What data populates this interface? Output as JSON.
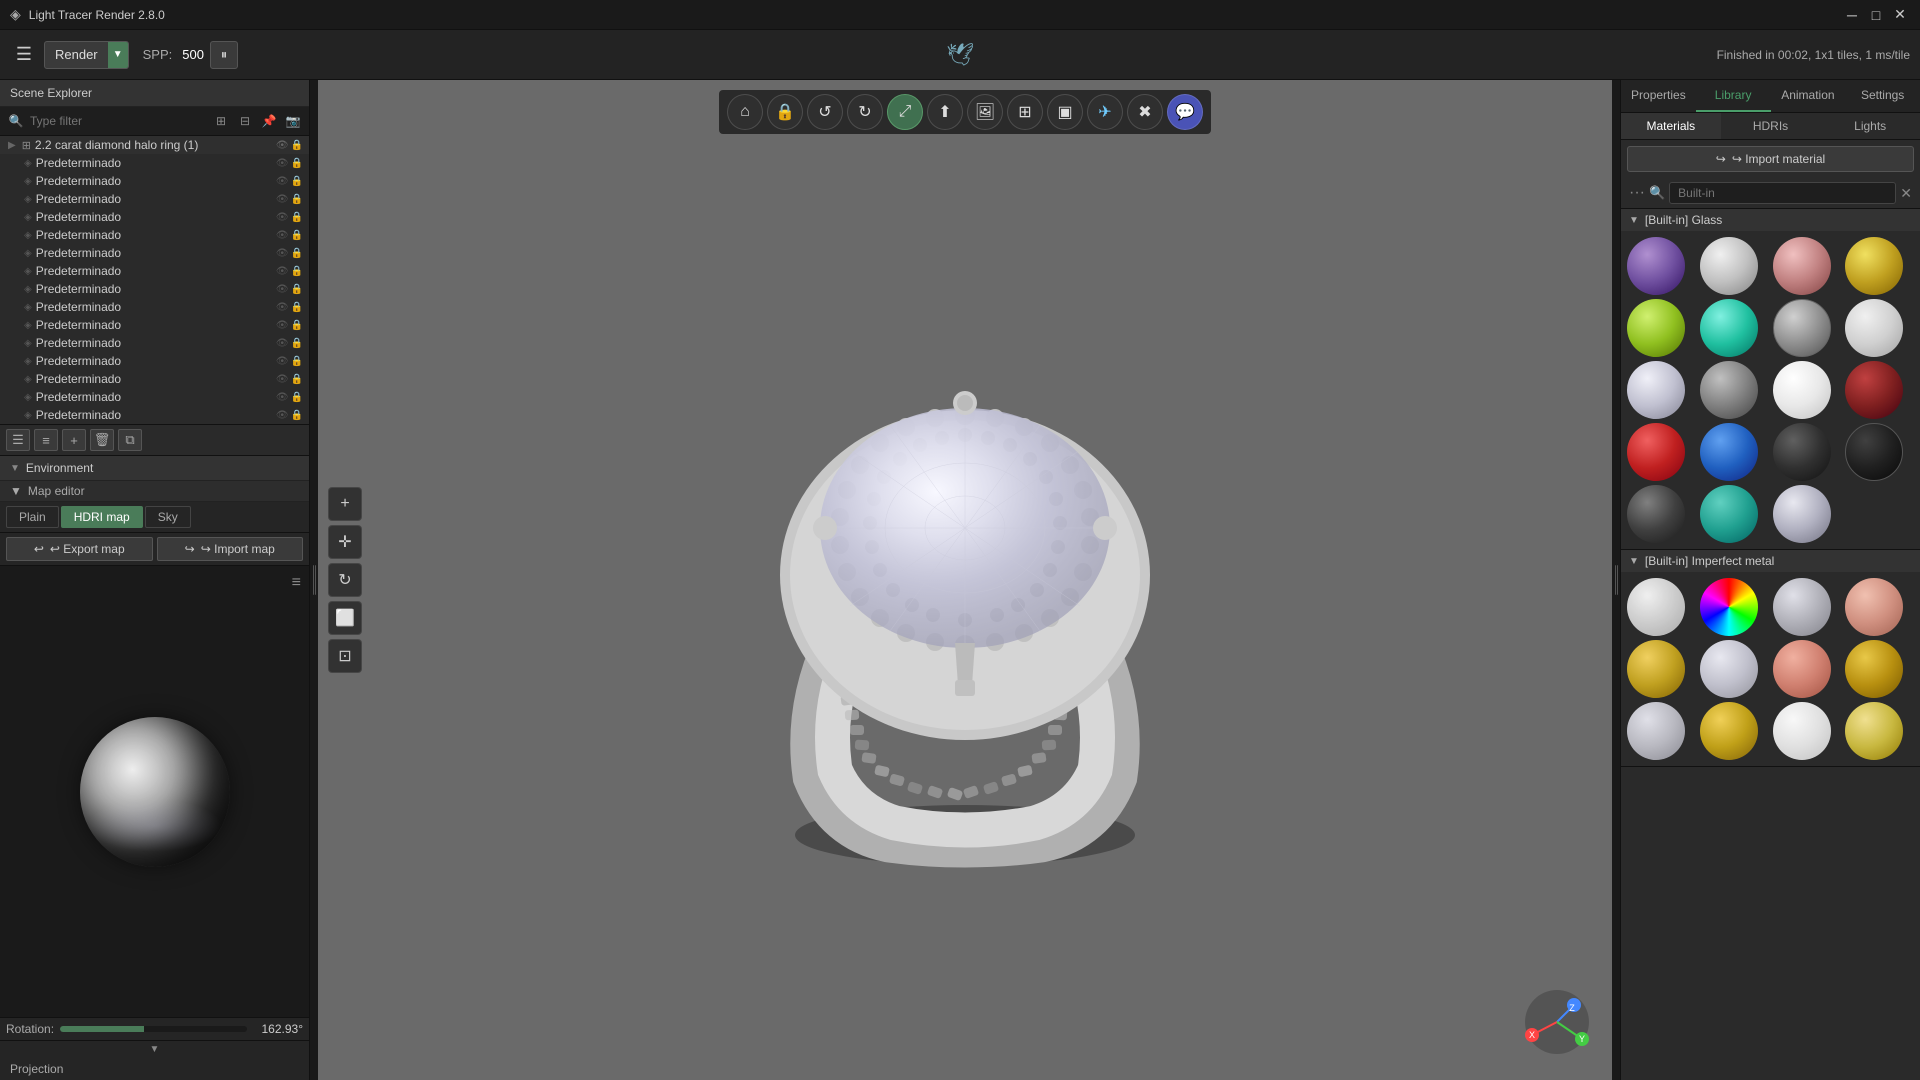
{
  "titlebar": {
    "title": "Light Tracer Render 2.8.0",
    "controls": [
      "minimize",
      "maximize",
      "close"
    ]
  },
  "toolbar": {
    "menu_icon": "☰",
    "render_label": "Render",
    "render_arrow": "▼",
    "spp_label": "SPP:",
    "spp_value": "500",
    "pause_icon": "⏸",
    "logo": "🕊",
    "status": "Finished in 00:02, 1x1 tiles, 1 ms/tile"
  },
  "scene_explorer": {
    "title": "Scene Explorer",
    "search_placeholder": "Type filter",
    "root_item": "2.2 carat diamond halo ring (1)",
    "children": [
      "Predeterminado",
      "Predeterminado",
      "Predeterminado",
      "Predeterminado",
      "Predeterminado",
      "Predeterminado",
      "Predeterminado",
      "Predeterminado",
      "Predeterminado",
      "Predeterminado",
      "Predeterminado",
      "Predeterminado",
      "Predeterminado",
      "Predeterminado",
      "Predeterminado"
    ]
  },
  "environment": {
    "title": "Environment",
    "section_label": "Map editor",
    "tabs": [
      "Plain",
      "HDRI map",
      "Sky"
    ],
    "active_tab": 1,
    "export_btn": "↩ Export map",
    "import_btn": "↪ Import map",
    "rotation_label": "Rotation:",
    "rotation_value": "162.93°",
    "projection_label": "Projection"
  },
  "viewport": {
    "toolbar_icons": [
      {
        "id": "home",
        "icon": "⌂",
        "label": "home-icon"
      },
      {
        "id": "lock",
        "icon": "🔒",
        "label": "lock-icon"
      },
      {
        "id": "undo",
        "icon": "↺",
        "label": "undo-icon"
      },
      {
        "id": "redo",
        "icon": "↻",
        "label": "redo-icon"
      },
      {
        "id": "expand",
        "icon": "⊞",
        "label": "expand-icon",
        "active": true
      },
      {
        "id": "up",
        "icon": "⬆",
        "label": "up-icon"
      },
      {
        "id": "image",
        "icon": "🖼",
        "label": "image-icon"
      },
      {
        "id": "grid",
        "icon": "⊞",
        "label": "grid-icon"
      },
      {
        "id": "view",
        "icon": "▣",
        "label": "view-icon"
      },
      {
        "id": "export",
        "icon": "✈",
        "label": "export-icon"
      },
      {
        "id": "close2",
        "icon": "✖",
        "label": "close-icon"
      },
      {
        "id": "discord",
        "icon": "💬",
        "label": "discord-icon"
      }
    ],
    "left_tools": [
      {
        "id": "add",
        "icon": "+",
        "label": "add-tool"
      },
      {
        "id": "move",
        "icon": "✛",
        "label": "move-tool"
      },
      {
        "id": "rotate",
        "icon": "↻",
        "label": "rotate-tool"
      },
      {
        "id": "copy",
        "icon": "⬜",
        "label": "copy-tool"
      },
      {
        "id": "select",
        "icon": "⊡",
        "label": "select-tool"
      }
    ]
  },
  "right_panel": {
    "tabs": [
      "Properties",
      "Library",
      "Animation",
      "Settings"
    ],
    "active_tab": 1,
    "mat_tabs": [
      "Materials",
      "HDRIs",
      "Lights"
    ],
    "active_mat_tab": 0,
    "import_btn": "↪ Import material",
    "filter_placeholder": "Built-in",
    "glass_section": "[Built-in] Glass",
    "imperfect_section": "[Built-in] Imperfect metal",
    "glass_materials": [
      "mat-purple",
      "mat-white-glass",
      "mat-pink-glass",
      "mat-yellow-glass",
      "mat-lime",
      "mat-cyan-glass",
      "mat-gray-glass",
      "mat-light-gray",
      "mat-silver",
      "mat-gray2",
      "mat-white",
      "mat-dark-red",
      "mat-red-glass",
      "mat-blue-glass",
      "mat-dark-glass",
      "mat-black-glass",
      "mat-dark-gray",
      "mat-teal",
      "mat-silver2"
    ],
    "imperfect_materials": [
      "mat-white-rough",
      "mat-rainbow",
      "mat-silver-rough",
      "mat-rose-gold",
      "mat-gold",
      "mat-silver3",
      "mat-pink-gold",
      "mat-gold-rough",
      "mat-silver4",
      "mat-gold2",
      "mat-white3",
      "mat-light-gold"
    ]
  }
}
